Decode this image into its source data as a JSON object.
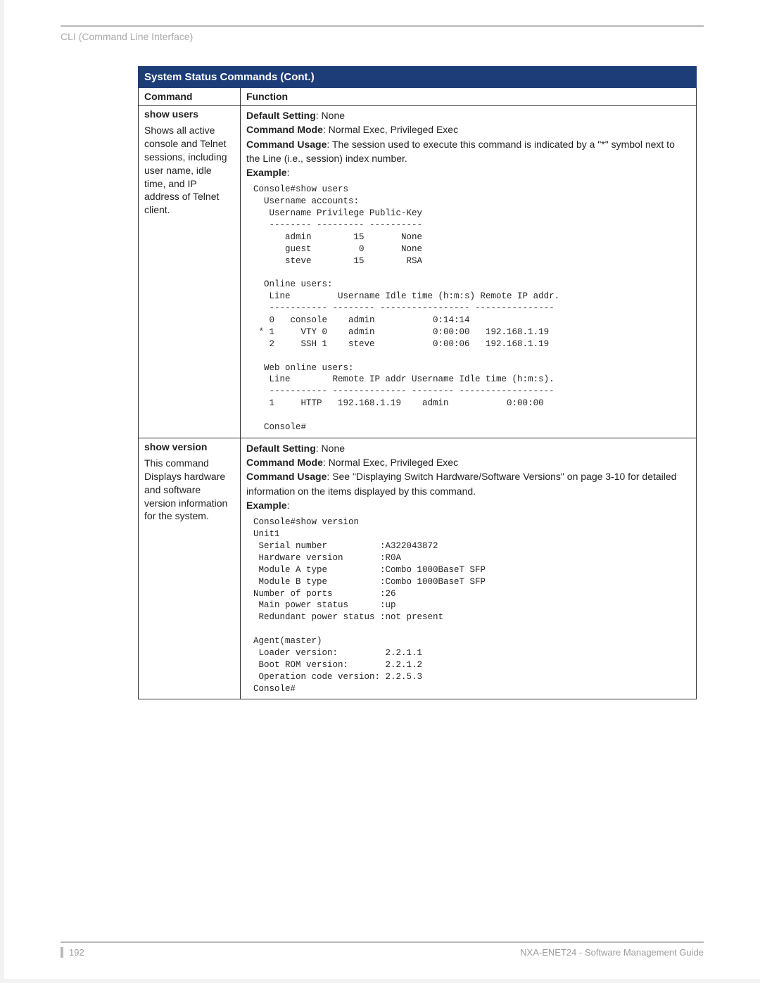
{
  "running_head": "CLI (Command Line Interface)",
  "table": {
    "title": "System Status Commands (Cont.)",
    "headers": {
      "command": "Command",
      "function": "Function"
    },
    "rows": [
      {
        "command": "show users",
        "description": "Shows all active console and Telnet sessions, including user name, idle time, and IP address of Telnet client.",
        "default_setting_label": "Default Setting",
        "default_setting_value": ": None",
        "command_mode_label": "Command Mode",
        "command_mode_value": ": Normal Exec, Privileged Exec",
        "command_usage_label": "Command Usage",
        "command_usage_value": ": The session used to execute this command is indicated by a \"*\" symbol next to the Line (i.e., session) index number.",
        "example_label": "Example",
        "example_text": "Console#show users\n  Username accounts:\n   Username Privilege Public-Key\n   -------- --------- ----------\n      admin        15       None\n      guest         0       None\n      steve        15        RSA\n\n  Online users:\n   Line         Username Idle time (h:m:s) Remote IP addr.\n   ----------- -------- ----------------- ---------------\n   0   console    admin           0:14:14\n * 1     VTY 0    admin           0:00:00   192.168.1.19\n   2     SSH 1    steve           0:00:06   192.168.1.19\n\n  Web online users:\n   Line        Remote IP addr Username Idle time (h:m:s).\n   ----------- -------------- -------- ------------------\n   1     HTTP   192.168.1.19    admin           0:00:00\n\n  Console#"
      },
      {
        "command": "show version",
        "description": "This command Displays hardware and software version information for the system.",
        "default_setting_label": "Default Setting",
        "default_setting_value": ": None",
        "command_mode_label": "Command Mode",
        "command_mode_value": ": Normal Exec, Privileged Exec",
        "command_usage_label": "Command Usage",
        "command_usage_value": ": See \"Displaying Switch Hardware/Software Versions\" on page 3-10 for detailed information on the items displayed by this command.",
        "example_label": "Example",
        "example_text": "Console#show version\nUnit1\n Serial number          :A322043872\n Hardware version       :R0A\n Module A type          :Combo 1000BaseT SFP\n Module B type          :Combo 1000BaseT SFP\nNumber of ports         :26\n Main power status      :up\n Redundant power status :not present\n\nAgent(master)\n Loader version:         2.2.1.1\n Boot ROM version:       2.2.1.2\n Operation code version: 2.2.5.3\nConsole#"
      }
    ]
  },
  "footer": {
    "page_number": "192",
    "doc_title": "NXA-ENET24 - Software Management Guide"
  }
}
